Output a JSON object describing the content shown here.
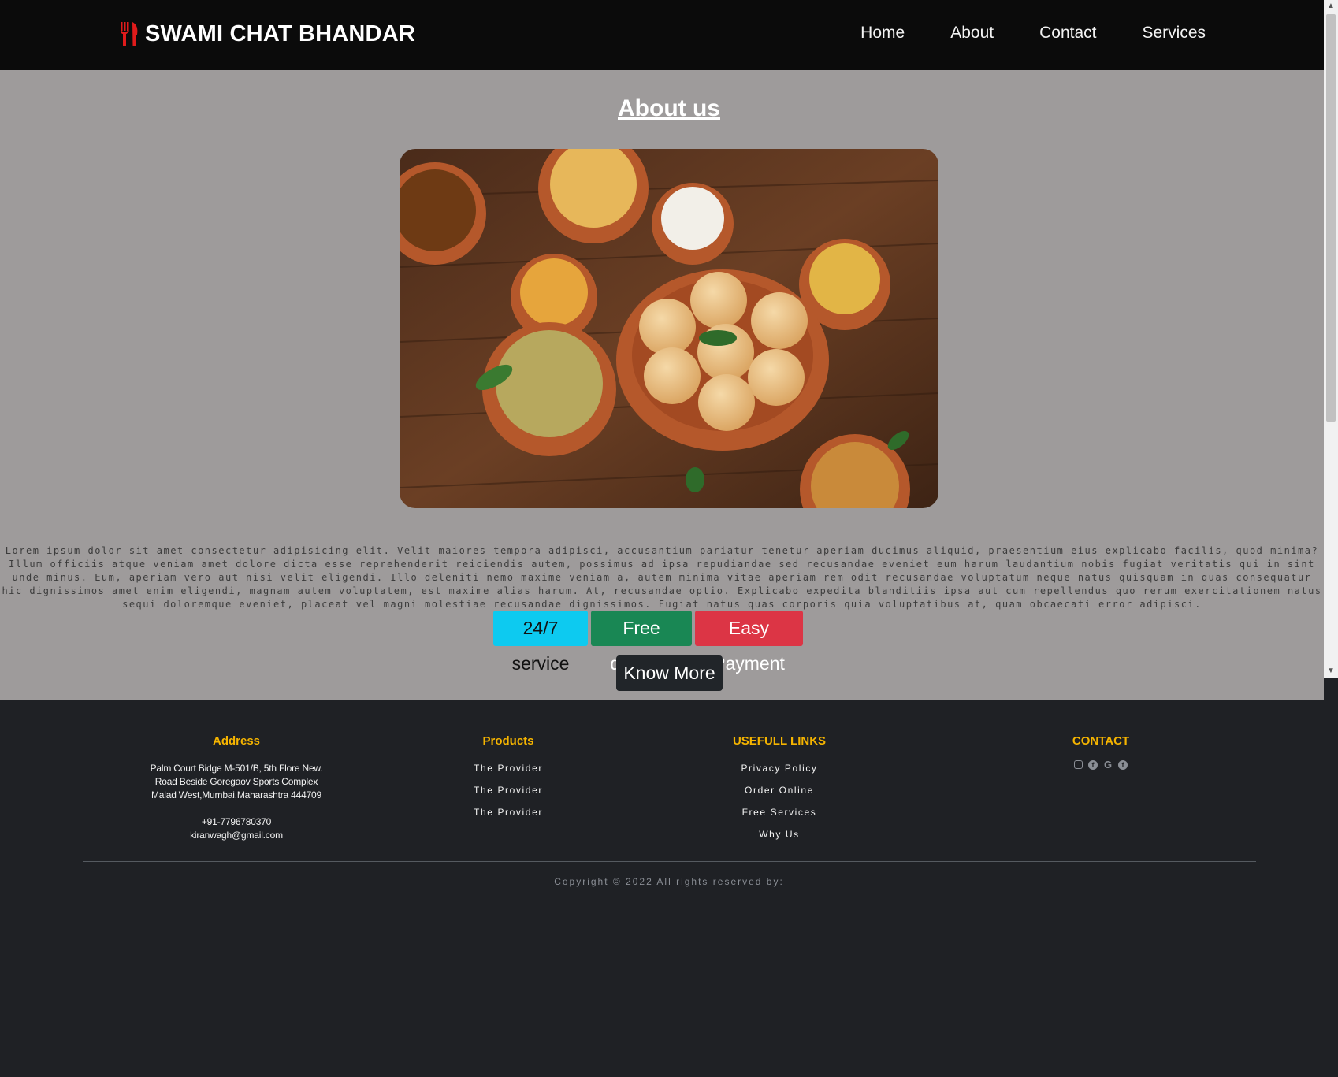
{
  "brand": {
    "name": "SWAMI CHAT BHANDAR",
    "icon": "utensils-icon",
    "icon_color": "#e01b1b"
  },
  "nav": [
    {
      "label": "Home"
    },
    {
      "label": "About"
    },
    {
      "label": "Contact"
    },
    {
      "label": "Services"
    }
  ],
  "about": {
    "title": "About us",
    "image": "pani-puri-food-photo",
    "description": "Lorem ipsum dolor sit amet consectetur adipisicing elit. Velit maiores tempora adipisci, accusantium pariatur tenetur aperiam ducimus aliquid, praesentium eius explicabo facilis, quod minima? Illum officiis atque veniam amet dolore dicta esse reprehenderit reiciendis autem, possimus ad ipsa repudiandae sed recusandae eveniet eum harum laudantium nobis fugiat veritatis qui in sint unde minus. Eum, aperiam vero aut nisi velit eligendi. Illo deleniti nemo maxime veniam a, autem minima vitae aperiam rem odit recusandae voluptatum neque natus quisquam in quas consequatur hic dignissimos amet enim eligendi, magnam autem voluptatem, est maxime alias harum. At, recusandae optio. Explicabo expedita blanditiis ipsa aut cum repellendus quo rerum exercitationem natus sequi doloremque eveniet, placeat vel magni molestiae recusandae dignissimos. Fugiat natus quas corporis quia voluptatibus at, quam obcaecati error adipisci.",
    "badges": [
      {
        "label": "24/7 service",
        "color": "#0dcaf0"
      },
      {
        "label": "Free delivery",
        "color": "#198754"
      },
      {
        "label": "Easy Payment",
        "color": "#dc3545"
      }
    ],
    "know_more": "Know More"
  },
  "footer": {
    "heading_color": "#f5b400",
    "address": {
      "heading": "Address",
      "line1": "Palm Court Bidge M-501/B, 5th Flore New.",
      "line2": "Road Beside Goregaov Sports Complex",
      "line3": "Malad West,Mumbai,Maharashtra 444709",
      "phone": "+91-7796780370",
      "email": "kiranwagh@gmail.com"
    },
    "products": {
      "heading": "Products",
      "items": [
        "The Provider",
        "The Provider",
        "The Provider"
      ]
    },
    "links": {
      "heading": "USEFULL LINKS",
      "items": [
        "Privacy Policy",
        "Order Online",
        "Free Services",
        "Why Us"
      ]
    },
    "contact": {
      "heading": "CONTACT",
      "icons": [
        "instagram-icon",
        "facebook-icon",
        "google-icon",
        "facebook-icon"
      ]
    },
    "copyright": "Copyright © 2022 All rights reserved by:"
  }
}
